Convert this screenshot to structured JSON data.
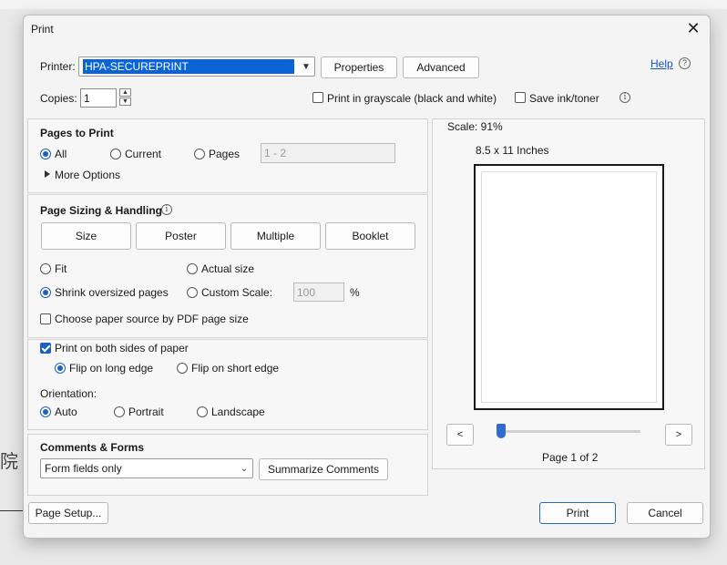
{
  "background": {
    "cjk_char": "院"
  },
  "dialog": {
    "title": "Print",
    "close_glyph": "✕",
    "printer_label": "Printer:",
    "printer_value": "HPA-SECUREPRINT",
    "properties_label": "Properties",
    "advanced_label": "Advanced",
    "help_label": "Help",
    "copies_label": "Copies:",
    "copies_value": "1",
    "grayscale_label": "Print in grayscale (black and white)",
    "save_ink_label": "Save ink/toner"
  },
  "pages_to_print": {
    "heading": "Pages to Print",
    "all_label": "All",
    "current_label": "Current",
    "pages_label": "Pages",
    "pages_placeholder": "1 - 2",
    "more_options_label": "More Options"
  },
  "page_sizing": {
    "heading": "Page Sizing & Handling",
    "tabs": [
      "Size",
      "Poster",
      "Multiple",
      "Booklet"
    ],
    "fit_label": "Fit",
    "actual_size_label": "Actual size",
    "shrink_label": "Shrink oversized pages",
    "custom_scale_label": "Custom Scale:",
    "custom_scale_value": "100",
    "percent_sign": "%",
    "paper_source_label": "Choose paper source by PDF page size"
  },
  "duplex": {
    "both_sides_label": "Print on both sides of paper",
    "long_edge_label": "Flip on long edge",
    "short_edge_label": "Flip on short edge",
    "orientation_label": "Orientation:",
    "auto_label": "Auto",
    "portrait_label": "Portrait",
    "landscape_label": "Landscape"
  },
  "comments_forms": {
    "heading": "Comments & Forms",
    "select_value": "Form fields only",
    "summarize_label": "Summarize Comments"
  },
  "preview": {
    "scale_label": "Scale:  91%",
    "paper_size": "8.5 x 11 Inches",
    "prev_glyph": "<",
    "next_glyph": ">",
    "page_indicator": "Page 1 of 2",
    "slider_position": 0.0
  },
  "footer": {
    "page_setup_label": "Page Setup...",
    "print_label": "Print",
    "cancel_label": "Cancel"
  },
  "colors": {
    "accent": "#1f5fbf",
    "selection": "#0a64d6",
    "link": "#1a56c4"
  }
}
